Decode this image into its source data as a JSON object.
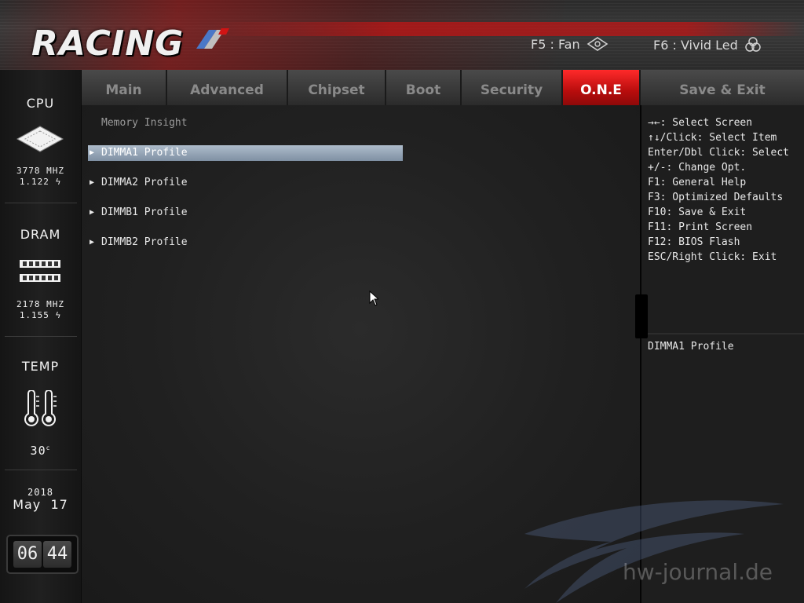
{
  "header": {
    "logo_text": "RACING",
    "f5_label": "F5 : Fan",
    "f6_label": "F6 : Vivid Led"
  },
  "sidebar": {
    "cpu": {
      "title": "CPU",
      "freq": "3778 MHZ",
      "voltage": "1.122"
    },
    "dram": {
      "title": "DRAM",
      "freq": "2178 MHZ",
      "voltage": "1.155"
    },
    "temp": {
      "title": "TEMP",
      "value": "30",
      "unit": "c"
    },
    "date": {
      "year": "2018",
      "month_day": "May  17"
    },
    "clock": {
      "hours": "06",
      "minutes": "44"
    }
  },
  "tabs": [
    {
      "label": "Main",
      "active": false
    },
    {
      "label": "Advanced",
      "active": false
    },
    {
      "label": "Chipset",
      "active": false
    },
    {
      "label": "Boot",
      "active": false
    },
    {
      "label": "Security",
      "active": false
    },
    {
      "label": "O.N.E",
      "active": true
    },
    {
      "label": "Save & Exit",
      "active": false
    }
  ],
  "main": {
    "section_title": "Memory Insight",
    "items": [
      {
        "label": "DIMMA1 Profile",
        "selected": true
      },
      {
        "label": "DIMMA2 Profile",
        "selected": false
      },
      {
        "label": "DIMMB1 Profile",
        "selected": false
      },
      {
        "label": "DIMMB2 Profile",
        "selected": false
      }
    ]
  },
  "help": {
    "lines": [
      "→←: Select Screen",
      "↑↓/Click: Select Item",
      "Enter/Dbl Click: Select",
      "+/-: Change Opt.",
      "F1: General Help",
      "F3: Optimized Defaults",
      "F10: Save & Exit",
      "F11: Print Screen",
      "F12: BIOS Flash",
      "ESC/Right Click: Exit"
    ],
    "description": "DIMMA1 Profile"
  },
  "watermark": "hw-journal.de",
  "colors": {
    "active_tab": "#d01414",
    "selected_row": "#97a8ba",
    "background": "#1c1c1c"
  }
}
